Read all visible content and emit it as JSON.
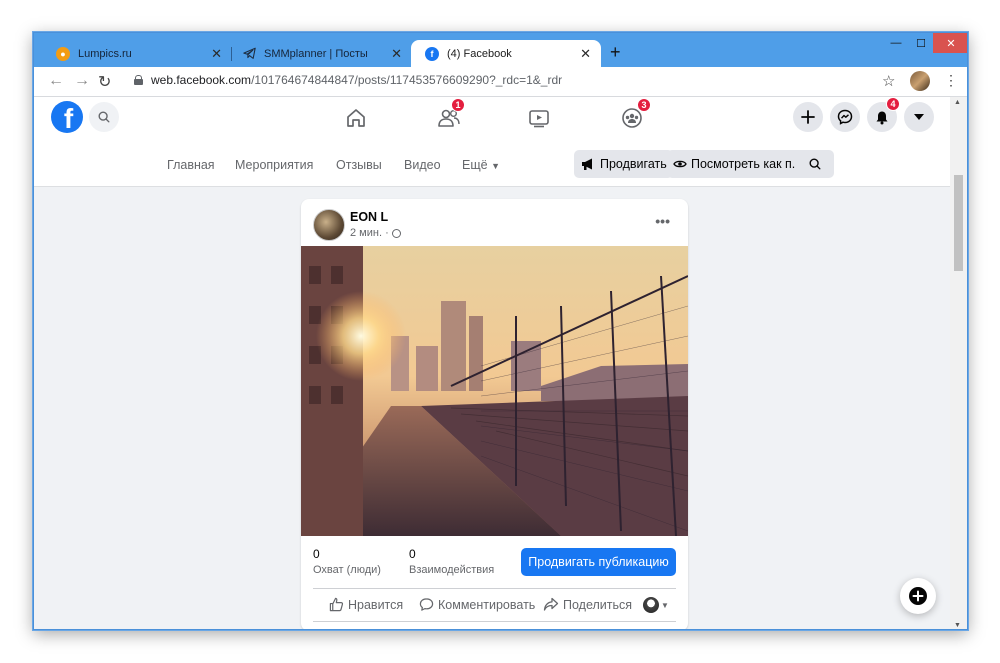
{
  "browser": {
    "tabs": [
      {
        "title": "Lumpics.ru",
        "favicon": "lumpics-icon"
      },
      {
        "title": "SMMplanner | Посты",
        "favicon": "telegram-icon"
      },
      {
        "title": "(4) Facebook",
        "favicon": "facebook-icon",
        "active": true
      }
    ],
    "url_host": "web.facebook.com",
    "url_path": "/101764674844847/posts/117453576609290?_rdc=1&_rdr"
  },
  "facebook": {
    "logo": "f",
    "badges": {
      "friends": "1",
      "groups": "3",
      "notifications": "4"
    },
    "subnav": {
      "items": [
        "Главная",
        "Мероприятия",
        "Отзывы",
        "Видео",
        "Ещё"
      ],
      "promote_label": "Продвигать",
      "view_as_label": "Посмотреть как п..."
    }
  },
  "post": {
    "author": "EON L",
    "time": "2 мин. ·",
    "reach_value": "0",
    "reach_label": "Охват (люди)",
    "engagement_value": "0",
    "engagement_label": "Взаимодействия",
    "promote_button": "Продвигать публикацию",
    "actions": {
      "like": "Нравится",
      "comment": "Комментировать",
      "share": "Поделиться"
    }
  },
  "colors": {
    "brand": "#1877f2",
    "badge": "#e41e3f",
    "tabstrip": "#4f9ee8"
  }
}
